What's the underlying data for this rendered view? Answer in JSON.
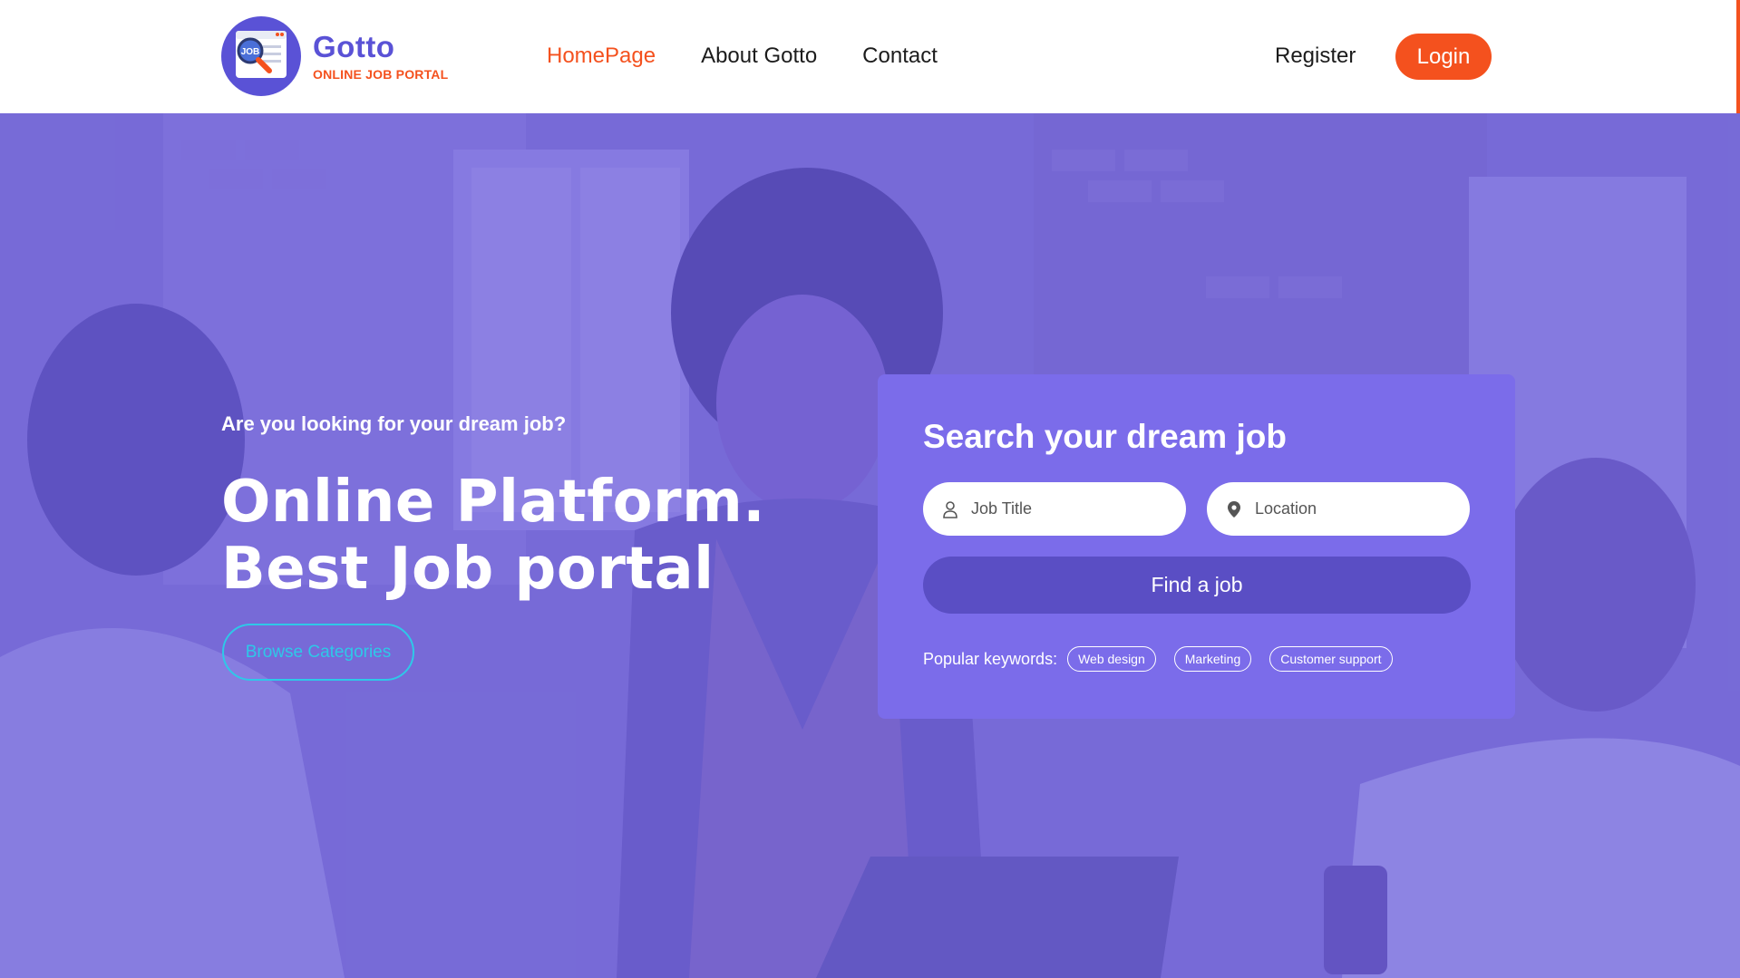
{
  "brand": {
    "name": "Gotto",
    "subtitle": "ONLINE JOB PORTAL",
    "logo_text": "JOB",
    "primary_color": "#5a52d6",
    "accent_color": "#f4511e"
  },
  "nav": {
    "items": [
      {
        "label": "HomePage",
        "active": true
      },
      {
        "label": "About Gotto",
        "active": false
      },
      {
        "label": "Contact",
        "active": false
      }
    ],
    "register_label": "Register",
    "login_label": "Login"
  },
  "hero": {
    "kicker": "Are you looking for your dream job?",
    "title_line1": "Online Platform.",
    "title_line2": "Best Job portal",
    "browse_label": "Browse Categories",
    "overlay_color": "#695edc"
  },
  "search": {
    "title": "Search your dream job",
    "job_placeholder": "Job Title",
    "job_icon": "user-icon",
    "location_placeholder": "Location",
    "location_icon": "map-pin-icon",
    "find_label": "Find a job",
    "keywords_label": "Popular keywords:",
    "keywords": [
      "Web design",
      "Marketing",
      "Customer support"
    ]
  }
}
